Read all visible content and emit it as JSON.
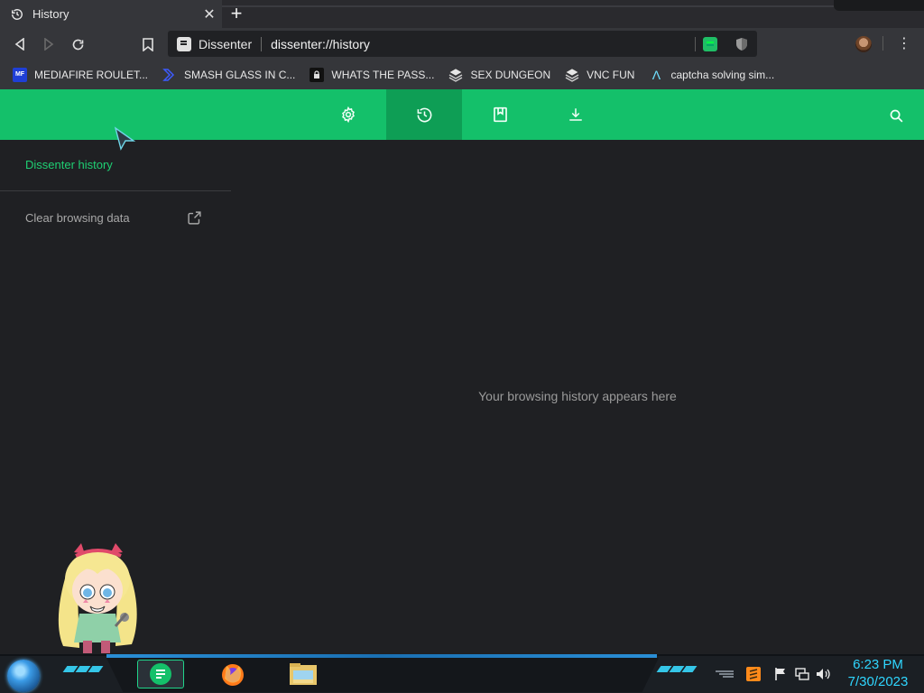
{
  "browser": {
    "tab": {
      "title": "History",
      "close": "✕"
    },
    "new_tab": "+",
    "omnibox": {
      "site_name": "Dissenter",
      "url": "dissenter://history"
    },
    "menu": "⋮"
  },
  "bookmarks": [
    {
      "label": "MEDIAFIRE ROULET...",
      "icon": "mediafire-icon",
      "icon_text": "MF"
    },
    {
      "label": "SMASH GLASS IN C...",
      "icon": "chevron-icon",
      "icon_text": ""
    },
    {
      "label": "WHATS THE PASS...",
      "icon": "lock-icon",
      "icon_text": ""
    },
    {
      "label": "SEX DUNGEON",
      "icon": "layers-icon",
      "icon_text": ""
    },
    {
      "label": "VNC FUN",
      "icon": "layers-icon",
      "icon_text": ""
    },
    {
      "label": "captcha solving sim...",
      "icon": "lambda-icon",
      "icon_text": "Λ"
    }
  ],
  "page": {
    "sidebar": {
      "title": "Dissenter history",
      "clear_label": "Clear browsing data"
    },
    "empty_message": "Your browsing history appears here"
  },
  "taskbar": {
    "time": "6:23 PM",
    "date": "7/30/2023"
  },
  "colors": {
    "accent": "#14c06a",
    "accent_active": "#0e9e55",
    "sidebar_title": "#1fcf73",
    "clock": "#2fd6ff"
  }
}
